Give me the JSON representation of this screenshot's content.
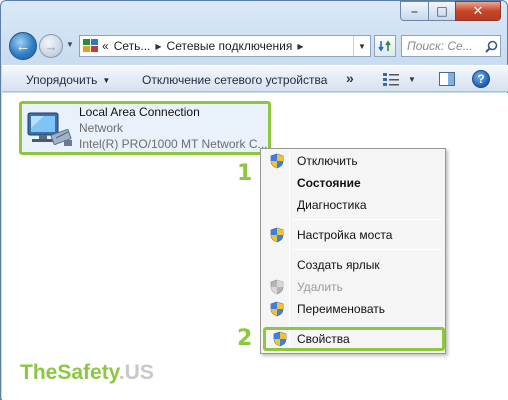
{
  "window": {
    "buttons": {
      "minimize_icon": "minimize-icon",
      "maximize_icon": "maximize-icon",
      "close_icon": "close-icon"
    }
  },
  "navigation": {
    "back_icon": "arrow-left-icon",
    "forward_icon": "arrow-right-icon",
    "address": {
      "overflow": "«",
      "crumbs": [
        "Сеть...",
        "Сетевые подключения"
      ]
    },
    "search_placeholder": "Поиск: Се..."
  },
  "command_bar": {
    "organize": "Упорядочить",
    "disable_device": "Отключение сетевого устройства",
    "more": "»"
  },
  "connection": {
    "title": "Local Area Connection",
    "status": "Network",
    "device": "Intel(R) PRO/1000 MT Network C..."
  },
  "step_labels": {
    "step1": "1",
    "step2": "2"
  },
  "context_menu": {
    "items": [
      {
        "label": "Отключить",
        "icon": "uac-shield-icon"
      },
      {
        "label": "Состояние",
        "bold": true
      },
      {
        "label": "Диагностика"
      },
      {
        "label": "Настройка моста",
        "icon": "uac-shield-icon"
      },
      {
        "label": "Создать ярлык"
      },
      {
        "label": "Удалить",
        "icon": "uac-shield-icon",
        "disabled": true
      },
      {
        "label": "Переименовать",
        "icon": "uac-shield-icon"
      },
      {
        "label": "Свойства",
        "icon": "uac-shield-icon",
        "highlighted": true
      }
    ]
  },
  "watermark": {
    "part1": "TheSafety",
    "part2": ".US"
  },
  "colors": {
    "highlight": "#8dc63f",
    "selection_bg": "#e9f1fa"
  }
}
